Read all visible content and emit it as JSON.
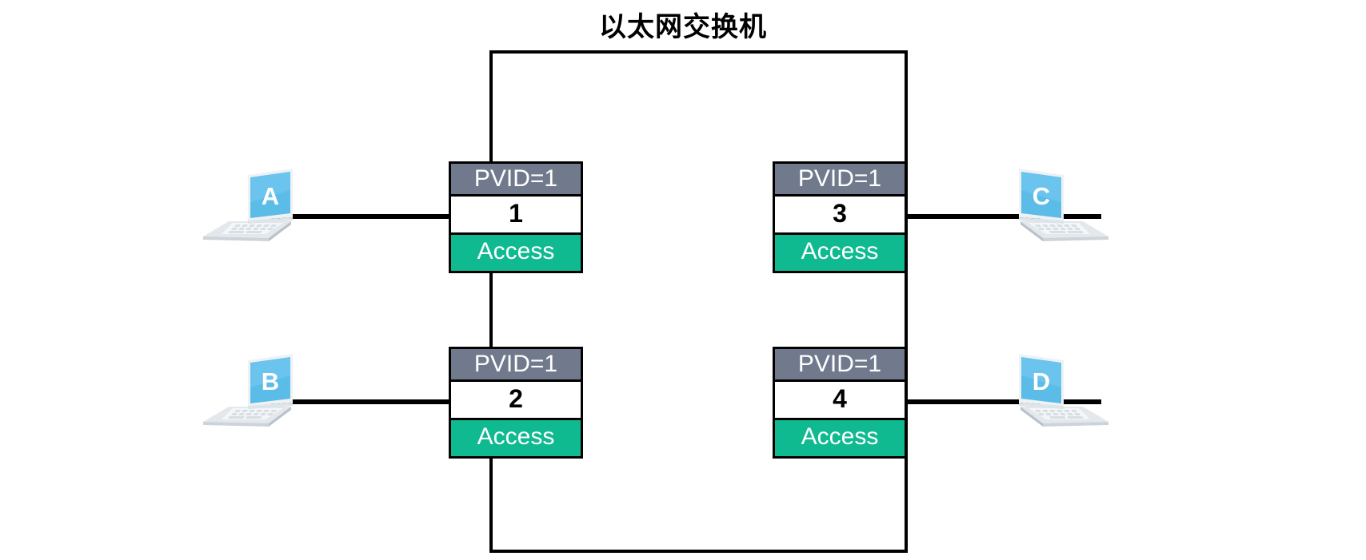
{
  "diagram": {
    "title": "以太网交换机",
    "type": "network-topology",
    "device": {
      "name": "ethernet-switch",
      "label": "以太网交换机"
    },
    "colors": {
      "pvid_band": "#717a8c",
      "mode_band": "#0fba91",
      "port_number_text": "#000000",
      "chassis_border": "#000000",
      "cable": "#000000",
      "laptop_screen": "#5bbce8",
      "background": "#ffffff"
    },
    "ports": [
      {
        "id": "port-1",
        "pvid_label": "PVID=1",
        "number": "1",
        "mode": "Access",
        "side": "left",
        "row": "top",
        "connected_host": "A"
      },
      {
        "id": "port-2",
        "pvid_label": "PVID=1",
        "number": "2",
        "mode": "Access",
        "side": "left",
        "row": "bottom",
        "connected_host": "B"
      },
      {
        "id": "port-3",
        "pvid_label": "PVID=1",
        "number": "3",
        "mode": "Access",
        "side": "right",
        "row": "top",
        "connected_host": "C"
      },
      {
        "id": "port-4",
        "pvid_label": "PVID=1",
        "number": "4",
        "mode": "Access",
        "side": "right",
        "row": "bottom",
        "connected_host": "D"
      }
    ],
    "hosts": [
      {
        "id": "host-a",
        "label": "A",
        "side": "left",
        "row": "top",
        "icon": "laptop-icon"
      },
      {
        "id": "host-b",
        "label": "B",
        "side": "left",
        "row": "bottom",
        "icon": "laptop-icon"
      },
      {
        "id": "host-c",
        "label": "C",
        "side": "right",
        "row": "top",
        "icon": "laptop-icon"
      },
      {
        "id": "host-d",
        "label": "D",
        "side": "right",
        "row": "bottom",
        "icon": "laptop-icon"
      }
    ],
    "links": [
      {
        "id": "link-a-1",
        "from": "A",
        "to": "port-1"
      },
      {
        "id": "link-b-2",
        "from": "B",
        "to": "port-2"
      },
      {
        "id": "link-c-3",
        "from": "C",
        "to": "port-3"
      },
      {
        "id": "link-d-4",
        "from": "D",
        "to": "port-4"
      }
    ]
  }
}
